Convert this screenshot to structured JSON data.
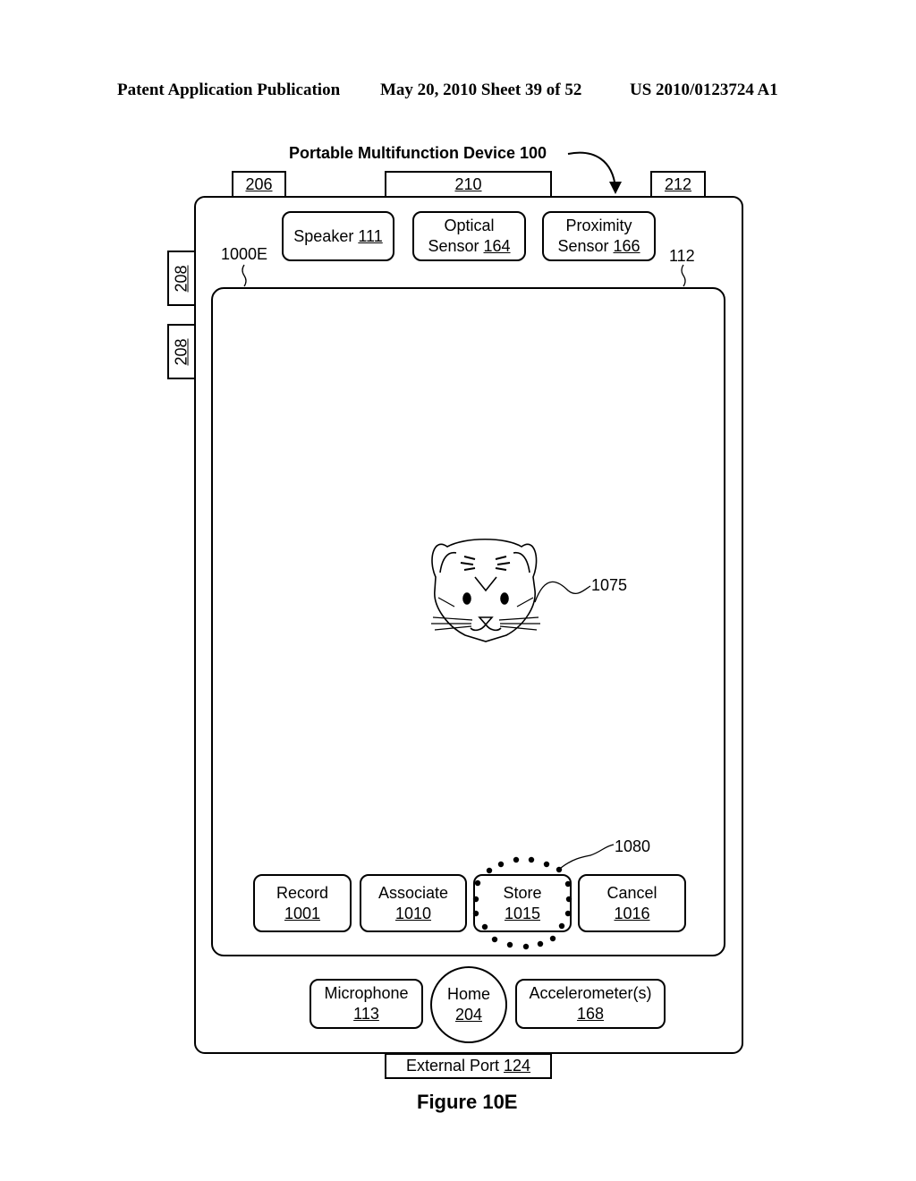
{
  "header": {
    "left": "Patent Application Publication",
    "middle": "May 20, 2010  Sheet 39 of 52",
    "right": "US 2010/0123724 A1"
  },
  "device": {
    "title": "Portable Multifunction Device 100",
    "top_tabs": [
      "206",
      "210",
      "212"
    ],
    "side_tabs": [
      "208",
      "208"
    ],
    "top_components": [
      {
        "line1": "Speaker",
        "ref": "111"
      },
      {
        "line1": "Optical",
        "line2": "Sensor",
        "ref": "164"
      },
      {
        "line1": "Proximity",
        "line2": "Sensor",
        "ref": "166"
      }
    ],
    "screen_label": "1000E",
    "touch_screen_label": "112",
    "image_label": "1075",
    "highlight_label": "1080",
    "buttons": [
      {
        "label": "Record",
        "ref": "1001"
      },
      {
        "label": "Associate",
        "ref": "1010"
      },
      {
        "label": "Store",
        "ref": "1015"
      },
      {
        "label": "Cancel",
        "ref": "1016"
      }
    ],
    "bottom_components": [
      {
        "label": "Microphone",
        "ref": "113"
      },
      {
        "label": "Home",
        "ref": "204"
      },
      {
        "label": "Accelerometer(s)",
        "ref": "168"
      }
    ],
    "external_port": {
      "label": "External Port",
      "ref": "124"
    }
  },
  "figure_caption": "Figure 10E"
}
